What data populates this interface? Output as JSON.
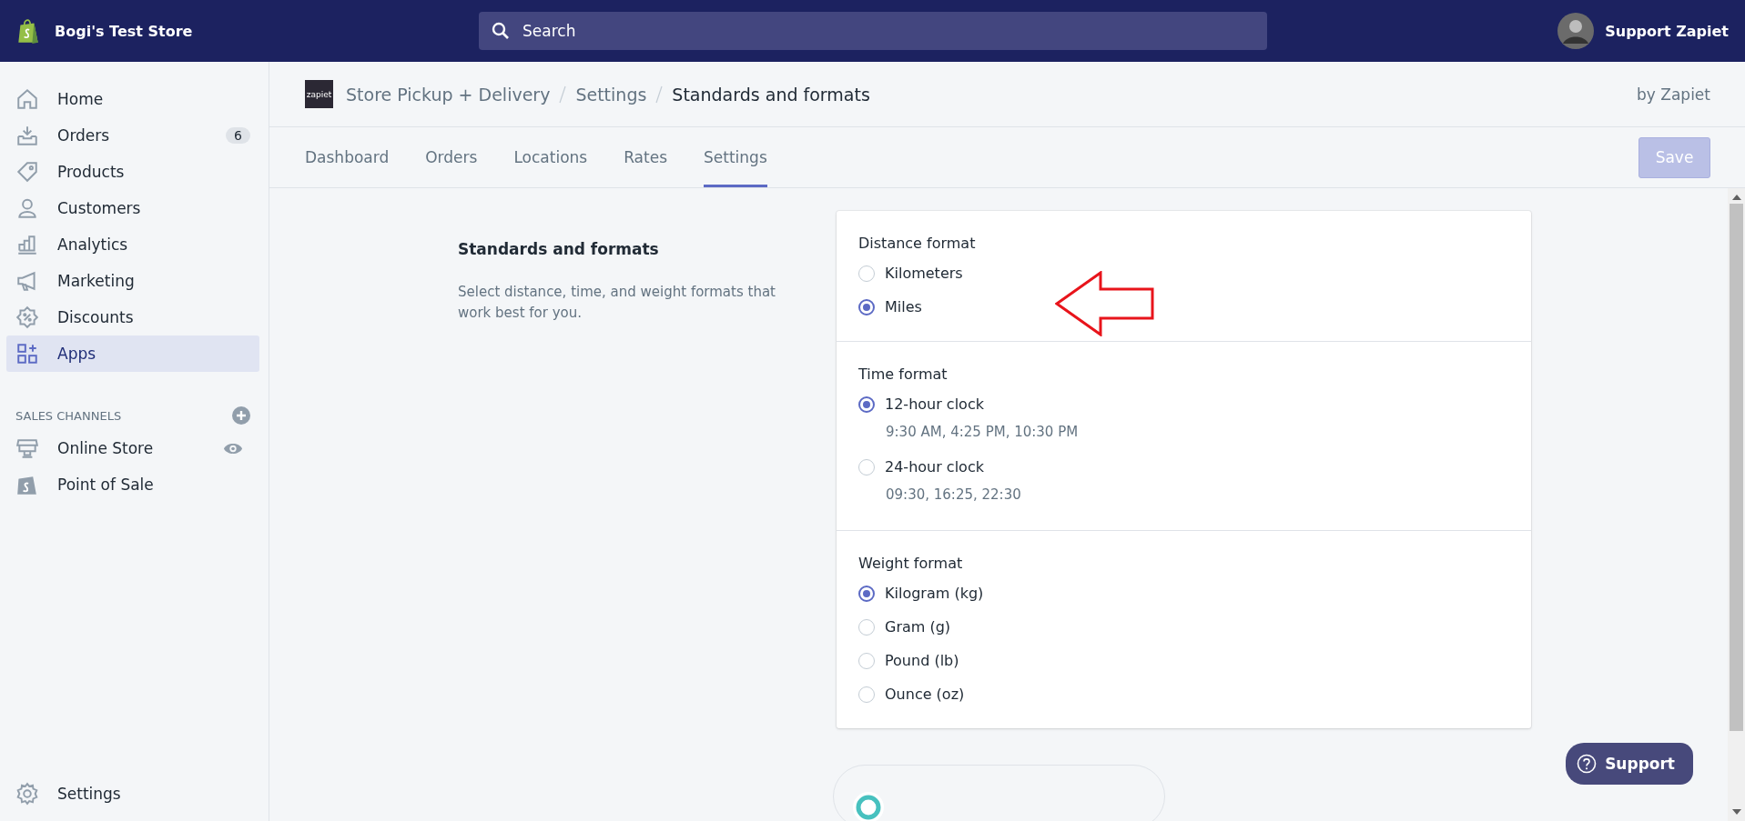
{
  "topbar": {
    "store_name": "Bogi's Test Store",
    "search": {
      "placeholder": "Search"
    },
    "user_name": "Support Zapiet"
  },
  "sidebar": {
    "items": [
      {
        "label": "Home",
        "kind": "home",
        "selected": false
      },
      {
        "label": "Orders",
        "kind": "orders",
        "selected": false,
        "badge": "6"
      },
      {
        "label": "Products",
        "kind": "tag",
        "selected": false
      },
      {
        "label": "Customers",
        "kind": "person",
        "selected": false
      },
      {
        "label": "Analytics",
        "kind": "chart",
        "selected": false
      },
      {
        "label": "Marketing",
        "kind": "megaphone",
        "selected": false
      },
      {
        "label": "Discounts",
        "kind": "discount",
        "selected": false
      },
      {
        "label": "Apps",
        "kind": "apps",
        "selected": true
      }
    ],
    "section_title": "SALES CHANNELS",
    "channels": [
      {
        "label": "Online Store",
        "kind": "store",
        "eye": true
      },
      {
        "label": "Point of Sale",
        "kind": "bag",
        "eye": false
      }
    ],
    "settings": "Settings"
  },
  "header": {
    "logo": "zapiet",
    "breadcrumbs": [
      "Store Pickup + Delivery",
      "Settings"
    ],
    "current": "Standards and formats",
    "by": "by Zapiet"
  },
  "tabs": [
    {
      "label": "Dashboard",
      "selected": false
    },
    {
      "label": "Orders",
      "selected": false
    },
    {
      "label": "Locations",
      "selected": false
    },
    {
      "label": "Rates",
      "selected": false
    },
    {
      "label": "Settings",
      "selected": true
    }
  ],
  "save_button": {
    "label": "Save",
    "disabled": true
  },
  "section": {
    "title": "Standards and formats",
    "description": "Select distance, time, and weight formats that work best for you."
  },
  "groups": [
    {
      "title": "Distance format",
      "options": [
        {
          "label": "Kilometers",
          "selected": false
        },
        {
          "label": "Miles",
          "selected": true
        }
      ]
    },
    {
      "title": "Time format",
      "options": [
        {
          "label": "12-hour clock",
          "hint": "9:30 AM, 4:25 PM, 10:30 PM",
          "selected": true
        },
        {
          "label": "24-hour clock",
          "hint": "09:30, 16:25, 22:30",
          "selected": false
        }
      ]
    },
    {
      "title": "Weight format",
      "options": [
        {
          "label": "Kilogram (kg)",
          "selected": true
        },
        {
          "label": "Gram (g)",
          "selected": false
        },
        {
          "label": "Pound (lb)",
          "selected": false
        },
        {
          "label": "Ounce (oz)",
          "selected": false
        }
      ]
    }
  ],
  "support_button": "Support"
}
